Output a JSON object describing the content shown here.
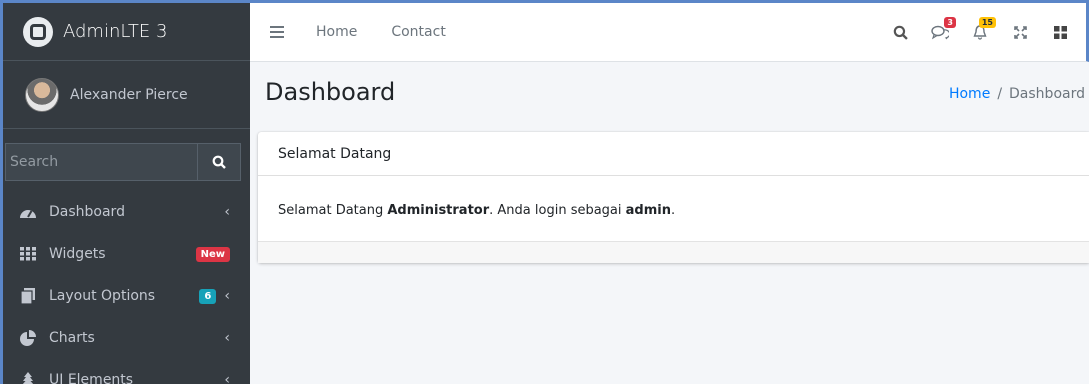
{
  "brand": {
    "name": "AdminLTE 3"
  },
  "user": {
    "name": "Alexander Pierce"
  },
  "search": {
    "placeholder": "Search"
  },
  "sidebar": {
    "items": [
      {
        "label": "Dashboard",
        "icon": "dashboard-icon"
      },
      {
        "label": "Widgets",
        "icon": "widgets-icon",
        "badge": "New"
      },
      {
        "label": "Layout Options",
        "icon": "layout-icon",
        "badge": "6"
      },
      {
        "label": "Charts",
        "icon": "chart-pie-icon"
      },
      {
        "label": "UI Elements",
        "icon": "tree-icon"
      }
    ]
  },
  "navbar": {
    "links": [
      "Home",
      "Contact"
    ],
    "messages_count": "3",
    "notifications_count": "15"
  },
  "content": {
    "title": "Dashboard",
    "breadcrumb": {
      "home": "Home",
      "current": "Dashboard"
    }
  },
  "card": {
    "header": "Selamat Datang",
    "body": {
      "prefix": "Selamat Datang ",
      "name": "Administrator",
      "middle": ". Anda login sebagai ",
      "role": "admin",
      "suffix": "."
    }
  },
  "colors": {
    "sidebar_bg": "#343a40",
    "accent": "#007bff",
    "badge_new": "#dc3545",
    "badge_info": "#17a2b8",
    "badge_warning": "#ffc107"
  }
}
